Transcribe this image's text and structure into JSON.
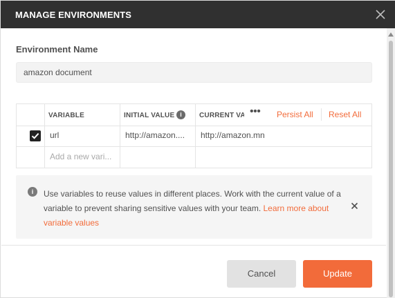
{
  "dialog": {
    "title": "MANAGE ENVIRONMENTS",
    "close_icon": "close-icon"
  },
  "environment": {
    "label": "Environment Name",
    "name_value": "amazon document"
  },
  "table": {
    "headers": {
      "variable": "VARIABLE",
      "initial_value": "INITIAL VALUE",
      "current_value": "CURRENT VAI"
    },
    "more_icon": "more-horizontal-icon",
    "persist_all": "Persist All",
    "reset_all": "Reset All",
    "rows": [
      {
        "checked": true,
        "variable": "url",
        "initial_value": "http://amazon....",
        "current_value": "http://amazon.mn"
      }
    ],
    "new_row_placeholder": "Add a new vari..."
  },
  "info": {
    "text": "Use variables to reuse values in different places. Work with the current value of a variable to prevent sharing sensitive values with your team. ",
    "link_text": "Learn more about variable values",
    "icon": "info-icon"
  },
  "footer": {
    "cancel_label": "Cancel",
    "update_label": "Update"
  },
  "colors": {
    "header_bg": "#303030",
    "accent": "#f26b3a",
    "cancel_bg": "#e2e2e2"
  }
}
